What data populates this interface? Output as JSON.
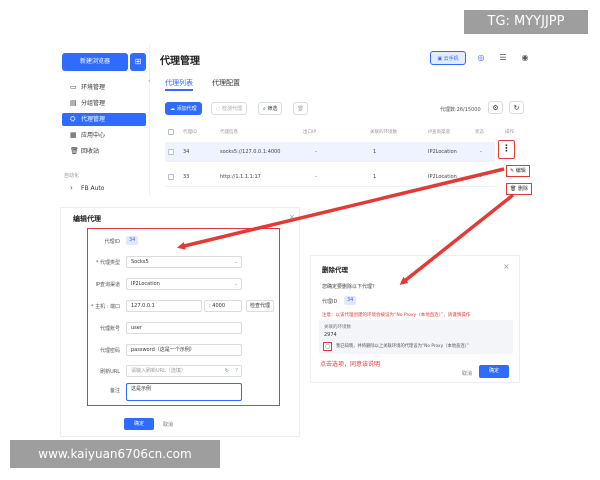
{
  "sidebar": {
    "new_browser_label": "新建浏览器",
    "items": [
      {
        "icon": "environment-icon",
        "glyph": "▭",
        "label": "环境管理"
      },
      {
        "icon": "group-icon",
        "glyph": "▤",
        "label": "分组管理"
      },
      {
        "icon": "proxy-icon",
        "glyph": "⛭",
        "label": "代理管理",
        "active": true
      },
      {
        "icon": "app-center-icon",
        "glyph": "▦",
        "label": "应用中心"
      },
      {
        "icon": "recycle-bin-icon",
        "glyph": "🗑",
        "label": "回收站"
      }
    ],
    "section_label": "自动化",
    "fb_label": "FB Auto"
  },
  "header": {
    "title": "代理管理",
    "cloud_phone_label": "云手机"
  },
  "tabs": [
    {
      "label": "代理列表",
      "active": true
    },
    {
      "label": "代理配置",
      "active": false
    }
  ],
  "toolbar": {
    "add_label": "添加代理",
    "check_label": "检测代理",
    "filter_label": "筛选",
    "count_text": "代理数:26/15000"
  },
  "table": {
    "columns": [
      "代理ID",
      "代理信息",
      "出口IP",
      "关联的环境数",
      "IP查询渠道",
      "状态",
      "操作"
    ],
    "rows": [
      {
        "id": "34",
        "info": "socks5://127.0.0.1:4000",
        "ip": "-",
        "envs": "1",
        "channel": "IP2Location",
        "status": "-"
      },
      {
        "id": "33",
        "info": "http://1.1.1.1:17",
        "ip": "-",
        "envs": "1",
        "channel": "IP2Location",
        "status": "-"
      }
    ]
  },
  "row_menu": {
    "more_glyph": "⋮",
    "edit_label": "编辑",
    "delete_label": "删除"
  },
  "edit_proxy": {
    "title": "编辑代理",
    "id_label": "代理ID",
    "id_value": "34",
    "type_label": "* 代理类型",
    "type_value": "Socks5",
    "channel_label": "IP查询渠道",
    "channel_value": "IP2Location",
    "host_label": "* 主机 : 端口",
    "host_value": "127.0.0.1",
    "port_value": ": 4000",
    "check_button": "检查代理",
    "account_label": "代理账号",
    "account_value": "user",
    "password_label": "代理密码",
    "password_value": "password（这是一个示例）",
    "refresh_label": "刷新URL",
    "refresh_placeholder": "请输入刷新URL（选填）",
    "remark_label": "备注",
    "remark_value": "这是示例",
    "confirm_label": "确定",
    "cancel_label": "取消"
  },
  "delete_proxy": {
    "title": "删除代理",
    "question": "您确定要删除以下代理？",
    "id_label": "代理ID",
    "id_value": "34",
    "warning": "注意：以该代理创建的环境会被设为“No Proxy（本地直连）”，请谨慎操作",
    "env_count_label": "关联的环境数",
    "env_count_value": "2974",
    "option_text": "我已知晓，并将删除以上关联环境的代理设为“No Proxy（本地直连）”",
    "annotation": "点击选项，同意该说明",
    "cancel_label": "取消",
    "confirm_label": "确定"
  },
  "watermarks": {
    "tg": "TG: MYYJJPP",
    "url": "www.kaiyuan6706cn.com"
  },
  "colors": {
    "primary": "#2f6bff",
    "annotation_red": "#e53935"
  }
}
